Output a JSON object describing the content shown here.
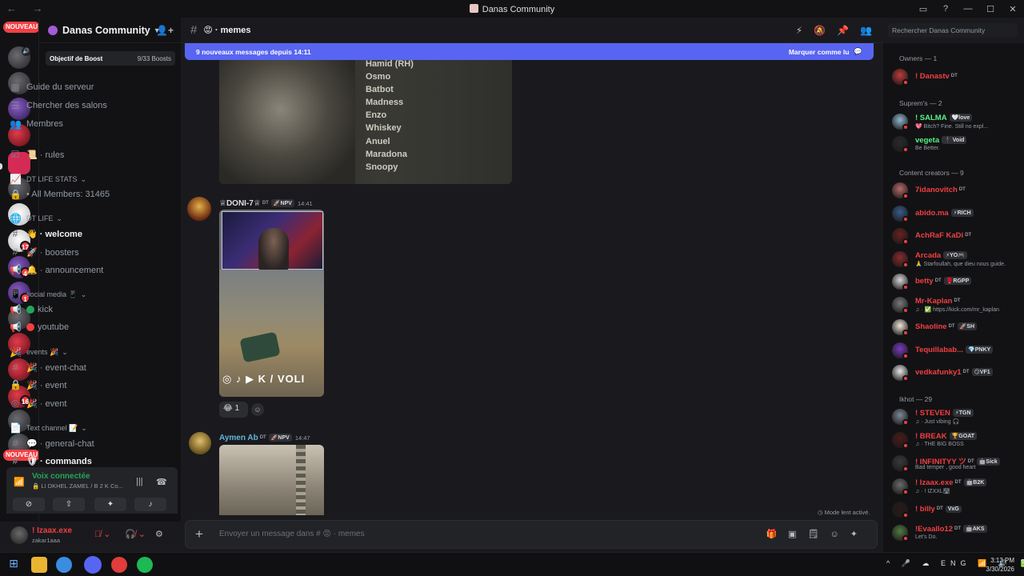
{
  "window": {
    "title": "Danas Community",
    "nav": "← →"
  },
  "rail": {
    "nouveau_top": "NOUVEAU",
    "nouveau_bottom": "NOUVEAU",
    "badges": [
      "17",
      "4",
      "1",
      "16",
      "2"
    ]
  },
  "guild": {
    "name": "Danas Community",
    "boost_label": "Objectif de Boost",
    "boost_count": "9/33 Boosts"
  },
  "sidebar": {
    "guide": "Guide du serveur",
    "browse": "Chercher des salons",
    "members": "Membres",
    "rules": "📜 · rules",
    "cat_stats": "DT LIFE STATS",
    "all_members": "• All Members: 31465",
    "cat_life": "DT LIFE",
    "welcome": "👋 · welcome",
    "boosters": "🚀 · boosters",
    "announcement": "🔔 · announcement",
    "cat_social": "social media 📱",
    "kick": "kick",
    "youtube": "youtube",
    "cat_events": "events 🎉",
    "event_chat": "🎉 · event-chat",
    "event1": "🎉 · event",
    "event2": "🎉 · event",
    "cat_text": "Text channel 📝",
    "general_chat": "💬 · general-chat",
    "commands": "🛡 · commands"
  },
  "voice": {
    "status": "Voix connectée",
    "channel": "🔒 LI DKHEL ZAMEL / B 2 K Co..."
  },
  "user": {
    "name": "! Izaax.exe",
    "handle": "zakar1aaa"
  },
  "channel": {
    "name": "😡 · memes",
    "search_placeholder": "Rechercher Danas Community",
    "new_messages": "9 nouveaux messages depuis 14:11",
    "mark_read": "Marquer comme lu",
    "composer_placeholder": "Envoyer un message dans # 😡 · memes",
    "slowmode": "Mode lent activé."
  },
  "image1_names": [
    "Hamid (RH)",
    "Osmo",
    "Batbot",
    "Madness",
    "Enzo",
    "Whiskey",
    "Anuel",
    "Maradona",
    "Snoopy"
  ],
  "messages": [
    {
      "author": "♕DONI-7♕",
      "dt": "DT",
      "tag": "🚀NPV",
      "time": "14:41",
      "overlay": "◎ ♪ ▶ K / VOLI",
      "reaction": "😂 1"
    },
    {
      "author": "Aymen Ab",
      "dt": "DT",
      "tag": "🚀NPV",
      "time": "14:47"
    }
  ],
  "member_groups": [
    {
      "label": "Owners — 1",
      "members": [
        {
          "name": "! Danastv",
          "dt": "DT",
          "status": "",
          "color": "#f23f43"
        }
      ]
    },
    {
      "label": "Suprem's — 2",
      "members": [
        {
          "name": "! SALMA",
          "tag": "🤍love",
          "status": "💖 Bitch? Fine. Still no expl...",
          "color": "#57f287"
        },
        {
          "name": "vegeta",
          "tag": "🕴 Void",
          "status": "Be Better.",
          "color": "#57f287"
        }
      ]
    },
    {
      "label": "Content creators — 9",
      "members": [
        {
          "name": "7idanovitch",
          "dt": "DT",
          "status": "",
          "color": "#f23f43"
        },
        {
          "name": "abido.ma",
          "tag": "⚡RICH",
          "status": "",
          "color": "#f23f43"
        },
        {
          "name": "AchRaF KaDi",
          "dt": "DT",
          "status": "",
          "color": "#f23f43"
        },
        {
          "name": "Arcada",
          "tag": "⚡YO🎮",
          "status": "🙏 Starfoullah, que dieu nous guide.",
          "color": "#f23f43"
        },
        {
          "name": "betty",
          "dt": "DT",
          "tag": "🥊RGPP",
          "status": "",
          "color": "#f23f43"
        },
        {
          "name": "Mr-Kaplan",
          "dt": "DT",
          "status": "♫ · ✅ https://kick.com/mr_kaplan",
          "color": "#f23f43"
        },
        {
          "name": "Shaoline",
          "dt": "DT",
          "tag": "🚀SH",
          "status": "",
          "color": "#f23f43"
        },
        {
          "name": "Tequillabab...",
          "tag": "💎PNKY",
          "status": "",
          "color": "#f23f43"
        },
        {
          "name": "vedkafunky1",
          "dt": "DT",
          "tag": "😏VF1",
          "status": "",
          "color": "#f23f43"
        }
      ]
    },
    {
      "label": "Ikhot — 29",
      "members": [
        {
          "name": "! STEVEN",
          "tag": "⚡TGN",
          "status": "♫ · Just vibing 🎧",
          "color": "#f23f43"
        },
        {
          "name": "! BREAK",
          "tag": "🏆GOAT",
          "status": "♫ · THE BIG BOSS",
          "color": "#f23f43"
        },
        {
          "name": "! INFINITYY ツ",
          "dt": "DT",
          "tag": "🤖Sick",
          "status": "Bad temper , good heart",
          "color": "#f23f43"
        },
        {
          "name": "! Izaax.exe",
          "dt": "DT",
          "tag": "🤖B2K",
          "status": "♫ · ! IZXXL🛣",
          "color": "#f23f43"
        },
        {
          "name": "! billy",
          "dt": "DT",
          "tag": "VxG",
          "status": "",
          "color": "#f23f43"
        },
        {
          "name": "!Evaallo12",
          "dt": "DT",
          "tag": "🤖AKS",
          "status": "Let's Do.",
          "color": "#f23f43"
        }
      ]
    }
  ],
  "taskbar": {
    "lang": "ENG",
    "time": "3:13 PM",
    "date": "3/30/2026"
  }
}
